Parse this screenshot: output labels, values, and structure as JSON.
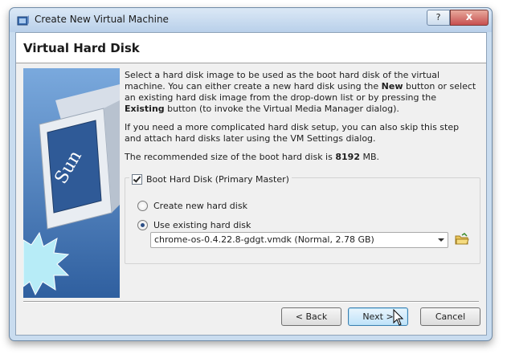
{
  "window": {
    "title": "Create New Virtual Machine",
    "help_label": "?",
    "close_label": "x"
  },
  "page": {
    "heading": "Virtual Hard Disk",
    "banner_logo_text": "Sun",
    "intro": {
      "t1": "Select a hard disk image to be used as the boot hard disk of the virtual machine. You can either create a new hard disk using the ",
      "b1": "New",
      "t2": " button or select an existing hard disk image from the drop-down list or by pressing the ",
      "b2": "Existing",
      "t3": " button (to invoke the Virtual Media Manager dialog)."
    },
    "advanced_text": "If you need a more complicated hard disk setup, you can also skip this step and attach hard disks later using the VM Settings dialog.",
    "recommended": {
      "prefix": "The recommended size of the boot hard disk is ",
      "size": "8192",
      "suffix": " MB."
    }
  },
  "disk_group": {
    "checkbox_label": "Boot Hard Disk (Primary Master)",
    "checkbox_checked": true,
    "radio_new_label": "Create new hard disk",
    "radio_existing_label": "Use existing hard disk",
    "selected_option": "existing",
    "disk_select_value": "chrome-os-0.4.22.8-gdgt.vmdk (Normal, 2.78 GB)"
  },
  "footer": {
    "back_label": "< Back",
    "next_label": "Next >",
    "cancel_label": "Cancel"
  }
}
